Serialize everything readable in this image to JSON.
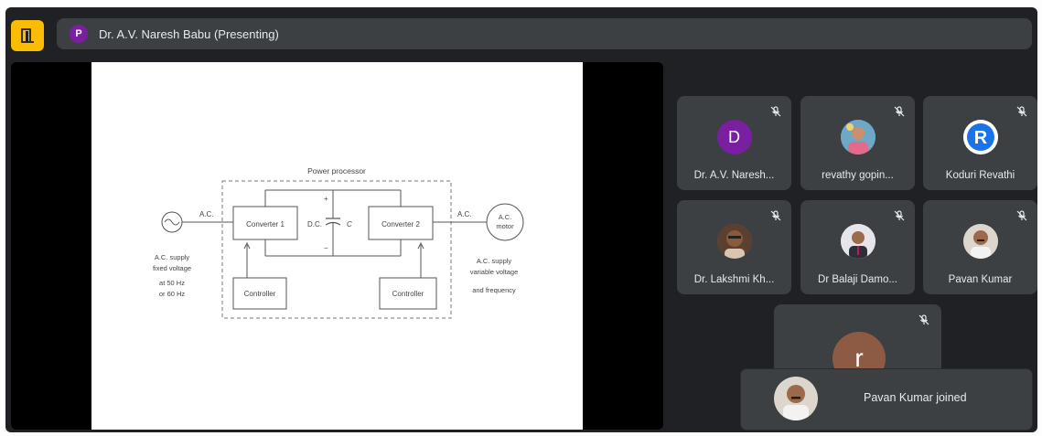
{
  "header": {
    "presenter_initial": "P",
    "presenter_label": "Dr. A.V. Naresh Babu (Presenting)",
    "accent_color": "#fbbc04"
  },
  "slide": {
    "title": "Power processor",
    "converter1": "Converter 1",
    "converter2": "Converter 2",
    "controller1": "Controller",
    "controller2": "Controller",
    "ac_left": "A.C.",
    "ac_right": "A.C.",
    "dc": "D.C.",
    "cap": "C",
    "plus": "+",
    "minus": "−",
    "motor_line1": "A.C.",
    "motor_line2": "motor",
    "left_caption": [
      "A.C. supply",
      "fixed voltage",
      "at 50 Hz",
      "or 60 Hz"
    ],
    "right_caption": [
      "A.C. supply",
      "variable voltage",
      "and frequency"
    ]
  },
  "participants": [
    {
      "name": "Dr. A.V. Naresh...",
      "initial": "D",
      "avatar_type": "letter",
      "avatar_color": "#7b1fa2"
    },
    {
      "name": "revathy gopin...",
      "initial": "",
      "avatar_type": "photo",
      "avatar_color": "#6fa7c6"
    },
    {
      "name": "Koduri Revathi",
      "initial": "R",
      "avatar_type": "logo",
      "avatar_color": "#ffffff"
    },
    {
      "name": "Dr. Lakshmi Kh...",
      "initial": "",
      "avatar_type": "photo",
      "avatar_color": "#7a5a45"
    },
    {
      "name": "Dr Balaji Damo...",
      "initial": "",
      "avatar_type": "photo",
      "avatar_color": "#b8b8c0"
    },
    {
      "name": "Pavan Kumar",
      "initial": "",
      "avatar_type": "photo",
      "avatar_color": "#a88a70"
    }
  ],
  "self_tile": {
    "initial": "r",
    "avatar_color": "#8d5b44"
  },
  "toast": {
    "message": "Pavan Kumar joined"
  }
}
